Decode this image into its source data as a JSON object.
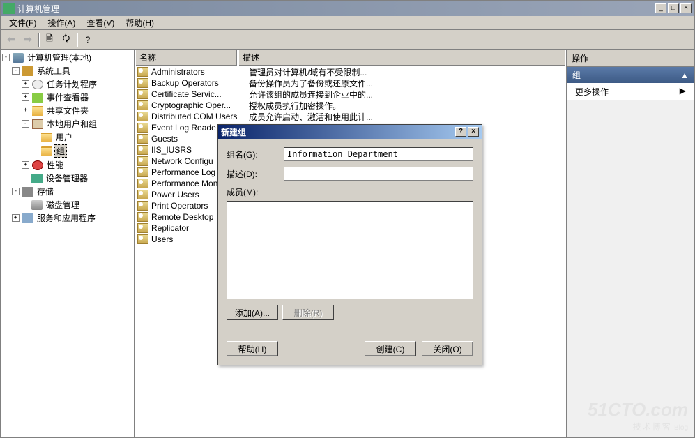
{
  "window": {
    "title": "计算机管理",
    "min": "_",
    "max": "□",
    "close": "×"
  },
  "menu": {
    "file": "文件(F)",
    "action": "操作(A)",
    "view": "查看(V)",
    "help": "帮助(H)"
  },
  "tree": {
    "root": "计算机管理(本地)",
    "system_tools": "系统工具",
    "task_scheduler": "任务计划程序",
    "event_viewer": "事件查看器",
    "shared_folders": "共享文件夹",
    "local_users_groups": "本地用户和组",
    "users": "用户",
    "groups": "组",
    "performance": "性能",
    "device_manager": "设备管理器",
    "storage": "存储",
    "disk_management": "磁盘管理",
    "services_apps": "服务和应用程序"
  },
  "list": {
    "col_name": "名称",
    "col_desc": "描述",
    "rows": [
      {
        "name": "Administrators",
        "desc": "管理员对计算机/域有不受限制..."
      },
      {
        "name": "Backup Operators",
        "desc": "备份操作员为了备份或还原文件..."
      },
      {
        "name": "Certificate Servic...",
        "desc": "允许该组的成员连接到企业中的..."
      },
      {
        "name": "Cryptographic Oper...",
        "desc": "授权成员执行加密操作。"
      },
      {
        "name": "Distributed COM Users",
        "desc": "成员允许启动、激活和使用此计..."
      },
      {
        "name": "Event Log Reade",
        "desc": ""
      },
      {
        "name": "Guests",
        "desc": ""
      },
      {
        "name": "IIS_IUSRS",
        "desc": ""
      },
      {
        "name": "Network Configu",
        "desc": ""
      },
      {
        "name": "Performance Log",
        "desc": ""
      },
      {
        "name": "Performance Mon",
        "desc": ""
      },
      {
        "name": "Power Users",
        "desc": ""
      },
      {
        "name": "Print Operators",
        "desc": ""
      },
      {
        "name": "Remote Desktop",
        "desc": ""
      },
      {
        "name": "Replicator",
        "desc": ""
      },
      {
        "name": "Users",
        "desc": ""
      }
    ]
  },
  "actions": {
    "header": "操作",
    "section": "组",
    "more": "更多操作",
    "arrow_up": "▲",
    "arrow_right": "▶"
  },
  "dialog": {
    "title": "新建组",
    "help_btn": "?",
    "close_btn": "×",
    "group_name_label": "组名(G):",
    "group_name_value": "Information Department",
    "desc_label": "描述(D):",
    "desc_value": "",
    "members_label": "成员(M):",
    "add_btn": "添加(A)...",
    "remove_btn": "删除(R)",
    "help_footer_btn": "帮助(H)",
    "create_btn": "创建(C)",
    "close_footer_btn": "关闭(O)"
  },
  "watermark": {
    "big": "51CTO.com",
    "small": "技术博客",
    "blog": "Blog"
  }
}
